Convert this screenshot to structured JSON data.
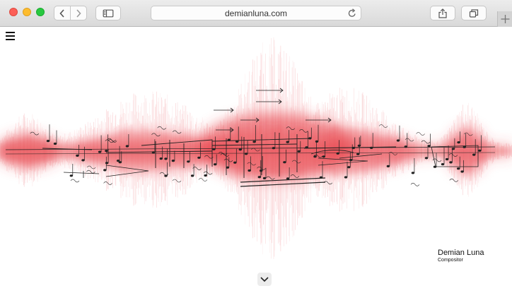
{
  "browser": {
    "url": "demianluna.com",
    "icons": {
      "back": "chevron-left-icon",
      "forward": "chevron-right-icon",
      "sidebar": "sidebar-icon",
      "reload": "reload-icon",
      "share": "share-icon",
      "tabs": "tabs-icon",
      "new_tab": "plus-icon"
    }
  },
  "site": {
    "name": "Demian Luna",
    "role": "Compositor",
    "accent": "#e8414a",
    "icons": {
      "menu": "hamburger-menu-icon",
      "scroll": "chevron-down-icon"
    }
  }
}
